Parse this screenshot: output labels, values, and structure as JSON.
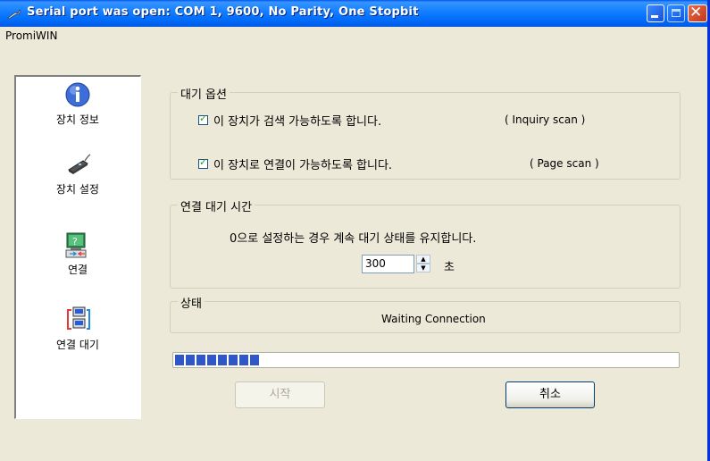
{
  "window": {
    "title": "Serial port was open: COM 1, 9600, No Parity, One Stopbit",
    "menu": "PromiWIN"
  },
  "sidebar": {
    "items": [
      {
        "label": "장치 정보",
        "icon": "info-icon"
      },
      {
        "label": "장치 설정",
        "icon": "device-icon"
      },
      {
        "label": "연결",
        "icon": "connect-icon"
      },
      {
        "label": "연결 대기",
        "icon": "wait-connection-icon"
      }
    ]
  },
  "standby_options": {
    "title": "대기 옵션",
    "inquiry": {
      "label": "이 장치가 검색 가능하도록 합니다.",
      "checked": true,
      "note": "( Inquiry scan )"
    },
    "page": {
      "label": "이 장치로 연결이 가능하도록 합니다.",
      "checked": true,
      "note": "( Page scan )"
    }
  },
  "wait_time": {
    "title": "연결 대기 시간",
    "description": "0으로 설정하는 경우 계속 대기 상태를 유지합니다.",
    "value": "300",
    "unit": "초"
  },
  "status": {
    "title": "상태",
    "text": "Waiting Connection"
  },
  "progress": {
    "blocks": 8,
    "color": "#2F57C6"
  },
  "buttons": {
    "start": "시작",
    "cancel": "취소"
  },
  "colors": {
    "titlebar": "#0058EE",
    "background": "#ECE9D8",
    "close": "#C1391B"
  }
}
